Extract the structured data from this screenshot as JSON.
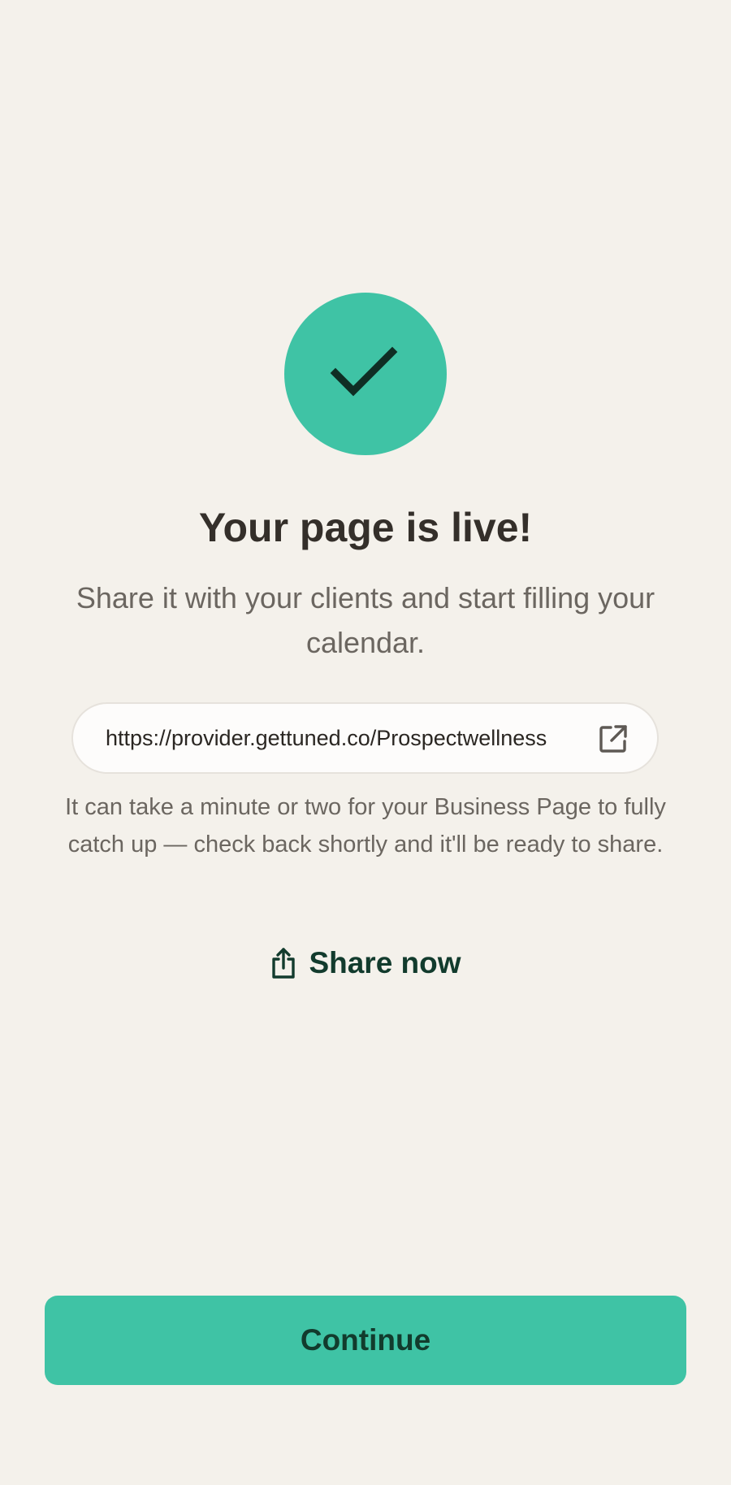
{
  "icons": {
    "status": "checkmark-icon",
    "link": "external-link-icon",
    "share": "share-icon"
  },
  "colors": {
    "background": "#f4f1eb",
    "accent": "#3fc3a5",
    "accent_text": "#123b2d",
    "title": "#342f2a",
    "muted_text": "#6b6660"
  },
  "title": "Your page is live!",
  "subtitle": "Share it with your clients and start filling your calendar.",
  "page_url": "https://provider.gettuned.co/Prospectwellness",
  "note": "It can take a minute or two for your Business Page to fully catch up — check back shortly and it'll be ready to share.",
  "share_label": "Share now",
  "continue_label": "Continue"
}
